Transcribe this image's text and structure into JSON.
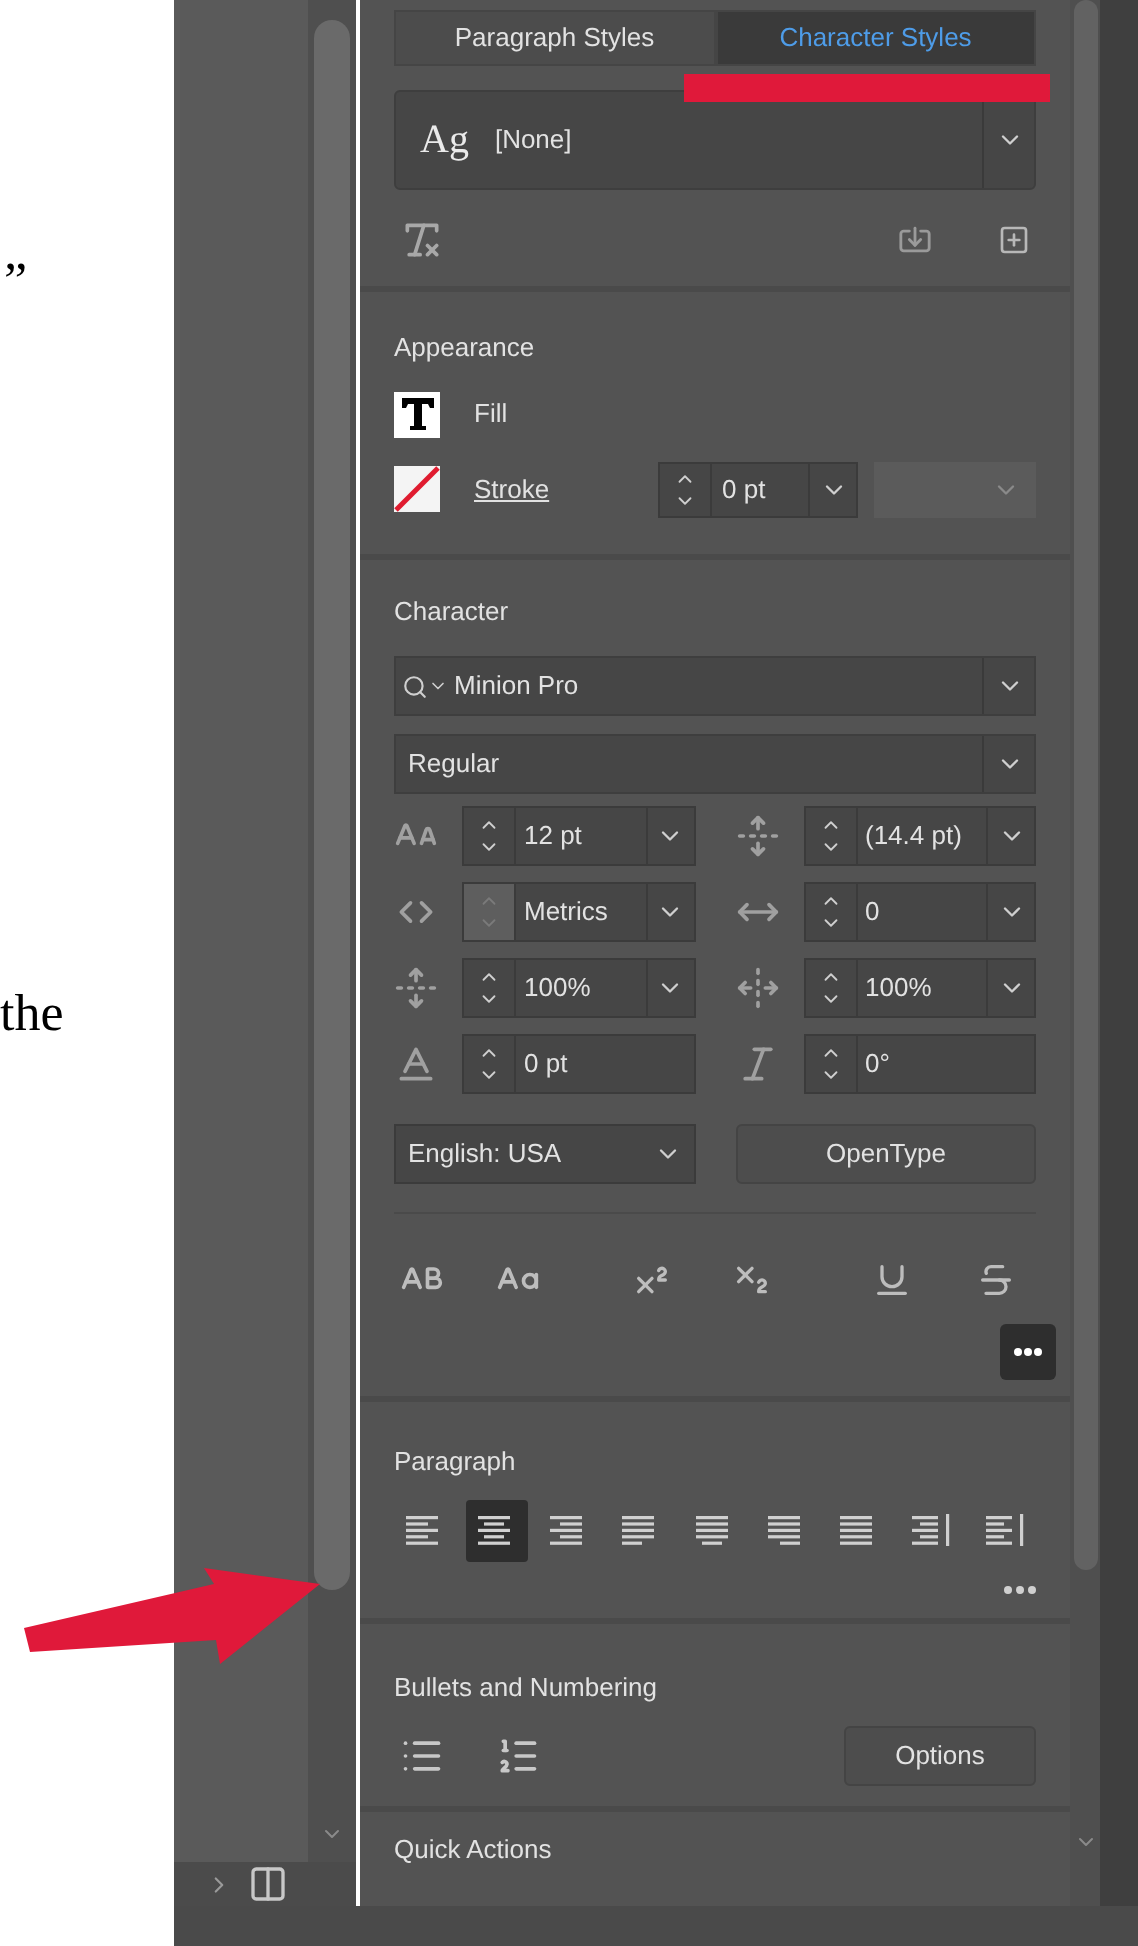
{
  "document": {
    "fragments": [
      "”",
      "the"
    ]
  },
  "tabs": [
    {
      "label": "Paragraph Styles",
      "selected": false
    },
    {
      "label": "Character Styles",
      "selected": true
    }
  ],
  "style_dropdown": {
    "preview": "Ag",
    "value": "[None]"
  },
  "appearance": {
    "title": "Appearance",
    "fill_label": "Fill",
    "stroke_label": "Stroke",
    "stroke_weight": "0 pt"
  },
  "character": {
    "title": "Character",
    "font": "Minion Pro",
    "style": "Regular",
    "fields": [
      {
        "kind": "size",
        "value": "12 pt",
        "menu": true,
        "disabled": false
      },
      {
        "kind": "leading",
        "value": "(14.4 pt)",
        "menu": true,
        "disabled": false
      },
      {
        "kind": "kerning",
        "value": "Metrics",
        "menu": true,
        "disabled": true
      },
      {
        "kind": "tracking",
        "value": "0",
        "menu": true,
        "disabled": false
      },
      {
        "kind": "vscale",
        "value": "100%",
        "menu": true,
        "disabled": false
      },
      {
        "kind": "hscale",
        "value": "100%",
        "menu": true,
        "disabled": false
      },
      {
        "kind": "baseline",
        "value": "0 pt",
        "menu": false,
        "disabled": false
      },
      {
        "kind": "skew",
        "value": "0°",
        "menu": false,
        "disabled": false
      }
    ],
    "language": "English: USA",
    "opentype_button": "OpenType"
  },
  "paragraph": {
    "title": "Paragraph",
    "alignments": [
      {
        "kind": "left",
        "selected": false
      },
      {
        "kind": "center",
        "selected": true
      },
      {
        "kind": "right",
        "selected": false
      },
      {
        "kind": "justify-left",
        "selected": false
      },
      {
        "kind": "justify-center",
        "selected": false
      },
      {
        "kind": "justify-right",
        "selected": false
      },
      {
        "kind": "justify-all",
        "selected": false
      },
      {
        "kind": "towards-spine",
        "selected": false
      },
      {
        "kind": "away-spine",
        "selected": false
      }
    ]
  },
  "bullets": {
    "title": "Bullets and Numbering",
    "options_button": "Options"
  },
  "quick_actions": {
    "title": "Quick Actions"
  }
}
